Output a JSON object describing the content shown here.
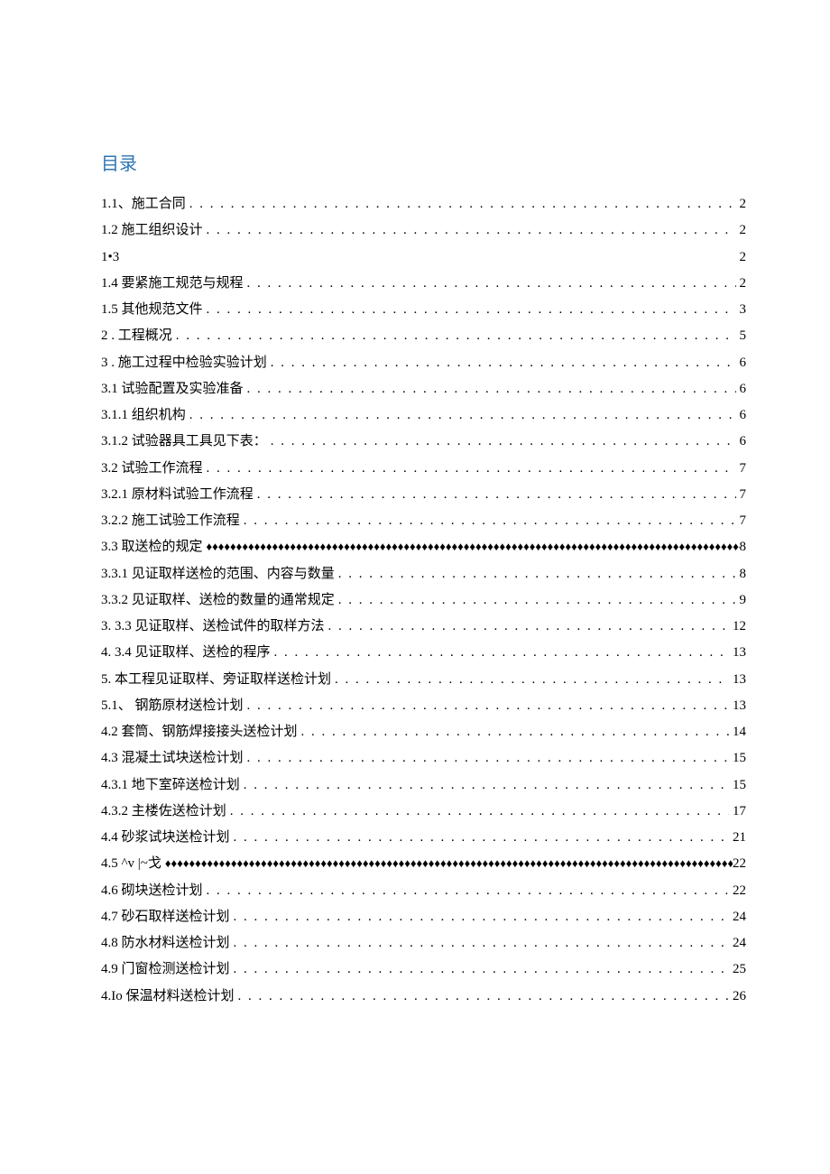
{
  "title": "目录",
  "rows": [
    {
      "label": "1.1、施工合同",
      "leader": "dots",
      "page": "2"
    },
    {
      "label": "1.2 施工组织设计",
      "leader": "dots",
      "page": "2"
    },
    {
      "label": "1•3",
      "leader": "blank",
      "page": "2"
    },
    {
      "label": "1.4  要紧施工规范与规程",
      "leader": "dots",
      "page": "2"
    },
    {
      "label": "1.5  其他规范文件",
      "leader": "dots",
      "page": "3"
    },
    {
      "label": "2  . 工程概况",
      "leader": "dots",
      "page": "5"
    },
    {
      "label": "3  . 施工过程中检验实验计划",
      "leader": "dots",
      "page": "6"
    },
    {
      "label": "3.1 试验配置及实验准备",
      "leader": "dots",
      "page": "6"
    },
    {
      "label": "3.1.1 组织机构",
      "leader": "dots",
      "page": "6"
    },
    {
      "label": "3.1.2 试验器具工具见下表：",
      "leader": "dots",
      "page": "6"
    },
    {
      "label": "3.2 试验工作流程",
      "leader": "dots",
      "page": "7"
    },
    {
      "label": "3.2.1 原材料试验工作流程",
      "leader": "dots",
      "page": "7"
    },
    {
      "label": "3.2.2 施工试验工作流程",
      "leader": "dots",
      "page": "7"
    },
    {
      "label": "3.3 取送检的规定",
      "leader": "diamonds",
      "page": "8"
    },
    {
      "label": "3.3.1 见证取样送检的范围、内容与数量",
      "leader": "dots",
      "page": "8"
    },
    {
      "label": "3.3.2 见证取样、送检的数量的通常规定",
      "leader": "dots",
      "page": "9"
    },
    {
      "label": "3.  3.3 见证取样、送检试件的取样方法",
      "leader": "dots",
      "page": "12"
    },
    {
      "label": "4.  3.4 见证取样、送检的程序",
      "leader": "dots",
      "page": "13"
    },
    {
      "label": "5.  本工程见证取样、旁证取样送检计划",
      "leader": "dots",
      "page": "13"
    },
    {
      "label": "5.1、  钢筋原材送检计划",
      "leader": "dots",
      "page": "13"
    },
    {
      "label": "4.2 套筒、钢筋焊接接头送检计划",
      "leader": "dots",
      "page": "14"
    },
    {
      "label": "4.3 混凝土试块送检计划",
      "leader": "dots",
      "page": "15"
    },
    {
      "label": "4.3.1 地下室碎送检计划",
      "leader": "dots",
      "page": "15"
    },
    {
      "label": "4.3.2 主楼佐送检计划",
      "leader": "dots",
      "page": "17"
    },
    {
      "label": "4.4 砂浆试块送检计划",
      "leader": "dots",
      "page": "21"
    },
    {
      "label": "4.5            ^v |~戈",
      "leader": "diamonds",
      "page": "22"
    },
    {
      "label": "4.6 砌块送检计划",
      "leader": "dots",
      "page": "22"
    },
    {
      "label": "4.7 砂石取样送检计划",
      "leader": "dots",
      "page": "24"
    },
    {
      "label": "4.8 防水材料送检计划",
      "leader": "dots",
      "page": "24"
    },
    {
      "label": "4.9 门窗检测送检计划",
      "leader": "dots",
      "page": "25"
    },
    {
      "label": "4.Io 保温材料送检计划",
      "leader": "dots",
      "page": "26"
    }
  ],
  "diamondFill": "♦♦♦♦♦♦♦♦♦♦♦♦♦♦♦♦♦♦♦♦♦♦♦♦♦♦♦♦♦♦♦♦♦♦♦♦♦♦♦♦♦♦♦♦♦♦♦♦♦♦♦♦♦♦♦♦♦♦♦♦♦♦♦♦♦♦♦♦♦♦♦♦♦♦♦♦♦♦♦♦♦♦♦♦♦♦♦♦♦♦♦♦♦♦♦♦♦♦♦♦♦♦♦♦♦♦♦♦♦♦♦♦♦♦♦♦♦♦♦♦"
}
